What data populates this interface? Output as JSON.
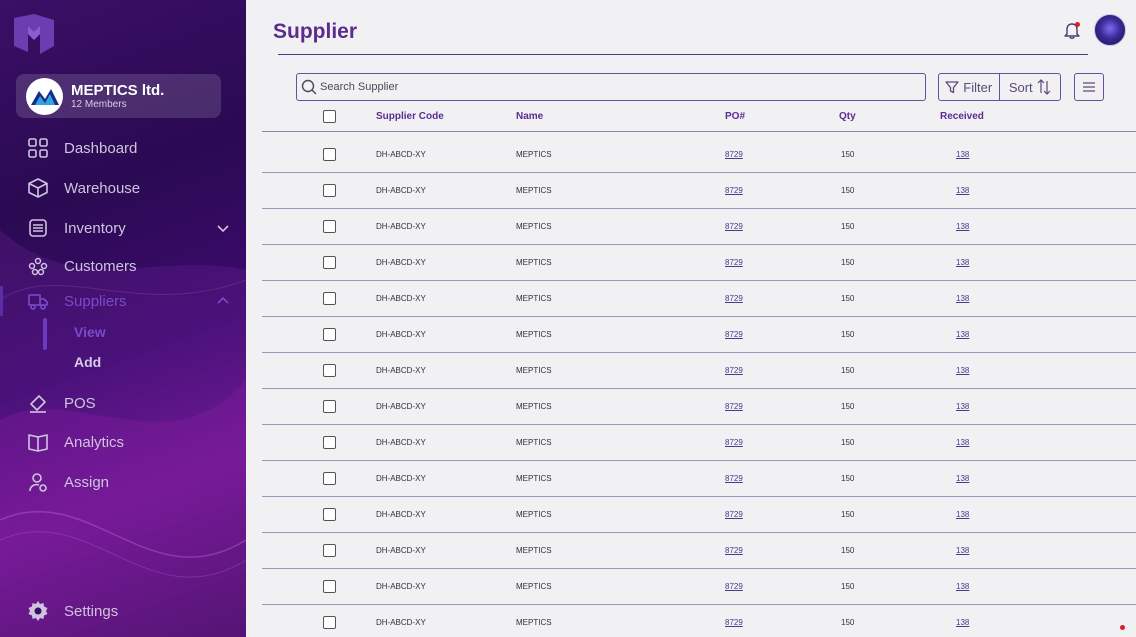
{
  "org": {
    "name": "MEPTICS ltd.",
    "members": "12 Members"
  },
  "nav": {
    "dashboard": "Dashboard",
    "warehouse": "Warehouse",
    "inventory": "Inventory",
    "customers": "Customers",
    "suppliers": "Suppliers",
    "view": "View",
    "add": "Add",
    "pos": "POS",
    "analytics": "Analytics",
    "assign": "Assign",
    "settings": "Settings"
  },
  "page": {
    "title": "Supplier"
  },
  "search": {
    "placeholder": "Search Supplier"
  },
  "toolbar": {
    "filter": "Filter",
    "sort": "Sort"
  },
  "table": {
    "headers": {
      "code": "Supplier Code",
      "name": "Name",
      "po": "PO#",
      "qty": "Qty",
      "received": "Received"
    },
    "rows": [
      {
        "code": "DH-ABCD-XY",
        "name": "MEPTICS",
        "po": "8729",
        "qty": "150",
        "received": "138"
      },
      {
        "code": "DH-ABCD-XY",
        "name": "MEPTICS",
        "po": "8729",
        "qty": "150",
        "received": "138"
      },
      {
        "code": "DH-ABCD-XY",
        "name": "MEPTICS",
        "po": "8729",
        "qty": "150",
        "received": "138"
      },
      {
        "code": "DH-ABCD-XY",
        "name": "MEPTICS",
        "po": "8729",
        "qty": "150",
        "received": "138"
      },
      {
        "code": "DH-ABCD-XY",
        "name": "MEPTICS",
        "po": "8729",
        "qty": "150",
        "received": "138"
      },
      {
        "code": "DH-ABCD-XY",
        "name": "MEPTICS",
        "po": "8729",
        "qty": "150",
        "received": "138"
      },
      {
        "code": "DH-ABCD-XY",
        "name": "MEPTICS",
        "po": "8729",
        "qty": "150",
        "received": "138"
      },
      {
        "code": "DH-ABCD-XY",
        "name": "MEPTICS",
        "po": "8729",
        "qty": "150",
        "received": "138"
      },
      {
        "code": "DH-ABCD-XY",
        "name": "MEPTICS",
        "po": "8729",
        "qty": "150",
        "received": "138"
      },
      {
        "code": "DH-ABCD-XY",
        "name": "MEPTICS",
        "po": "8729",
        "qty": "150",
        "received": "138"
      },
      {
        "code": "DH-ABCD-XY",
        "name": "MEPTICS",
        "po": "8729",
        "qty": "150",
        "received": "138"
      },
      {
        "code": "DH-ABCD-XY",
        "name": "MEPTICS",
        "po": "8729",
        "qty": "150",
        "received": "138"
      },
      {
        "code": "DH-ABCD-XY",
        "name": "MEPTICS",
        "po": "8729",
        "qty": "150",
        "received": "138"
      },
      {
        "code": "DH-ABCD-XY",
        "name": "MEPTICS",
        "po": "8729",
        "qty": "150",
        "received": "138"
      }
    ]
  },
  "colors": {
    "accent": "#5a2c91",
    "sidebar": "#3a0f66",
    "notification": "#d4202a"
  }
}
